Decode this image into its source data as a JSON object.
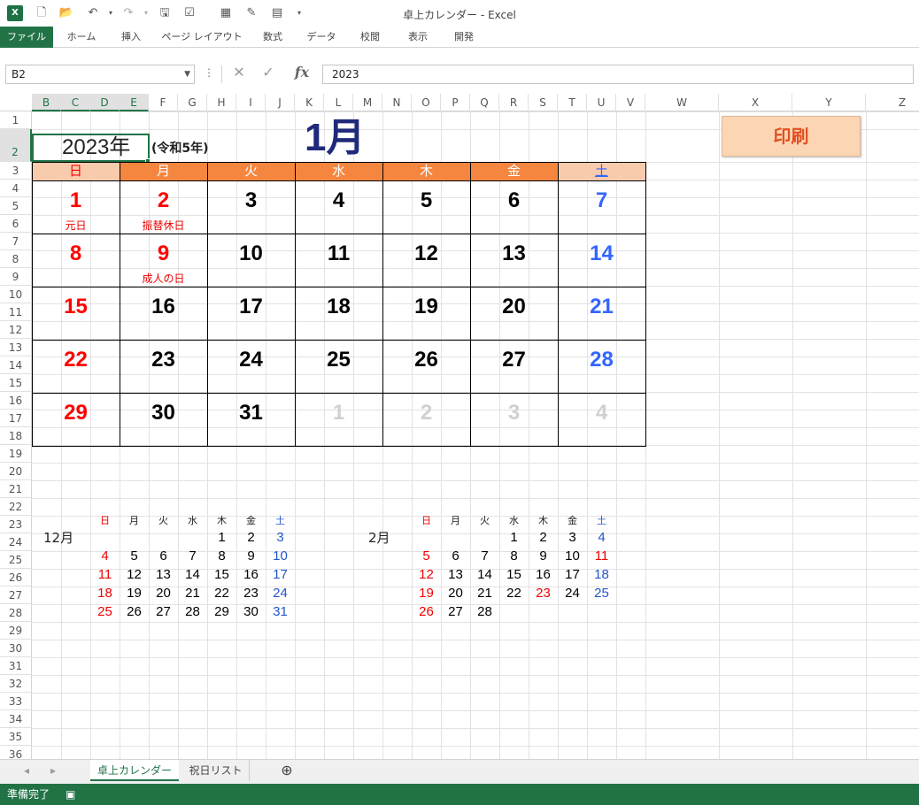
{
  "window": {
    "title": "卓上カレンダー - Excel",
    "app_icon": "X"
  },
  "quick_access": {
    "icons": [
      "new-file-icon",
      "open-folder-icon",
      "undo-icon",
      "redo-icon",
      "save-online-icon",
      "check-list-icon",
      "form-icon",
      "edit-icon",
      "chart-icon"
    ]
  },
  "ribbon": {
    "tabs": [
      "ファイル",
      "ホーム",
      "挿入",
      "ページ レイアウト",
      "数式",
      "データ",
      "校閲",
      "表示",
      "開発"
    ]
  },
  "formula_bar": {
    "name_box": "B2",
    "value": "2023",
    "fx": "fx"
  },
  "columns": [
    "B",
    "C",
    "D",
    "E",
    "F",
    "G",
    "H",
    "I",
    "J",
    "K",
    "L",
    "M",
    "N",
    "O",
    "P",
    "Q",
    "R",
    "S",
    "T",
    "U",
    "V",
    "W",
    "X",
    "Y",
    "Z"
  ],
  "rows": [
    "1",
    "2",
    "3",
    "4",
    "5",
    "6",
    "7",
    "8",
    "9",
    "10",
    "11",
    "12",
    "13",
    "14",
    "15",
    "16",
    "17",
    "18",
    "19",
    "20",
    "21",
    "22",
    "23",
    "24",
    "25",
    "26",
    "27",
    "28",
    "29",
    "30",
    "31",
    "32",
    "33",
    "34",
    "35",
    "36"
  ],
  "calendar": {
    "year_label": "2023年",
    "era_label": "(令和5年)",
    "month_label": "1月",
    "weekdays": [
      "日",
      "月",
      "火",
      "水",
      "木",
      "金",
      "土"
    ],
    "weeks": [
      [
        "1",
        "2",
        "3",
        "4",
        "5",
        "6",
        "7"
      ],
      [
        "8",
        "9",
        "10",
        "11",
        "12",
        "13",
        "14"
      ],
      [
        "15",
        "16",
        "17",
        "18",
        "19",
        "20",
        "21"
      ],
      [
        "22",
        "23",
        "24",
        "25",
        "26",
        "27",
        "28"
      ],
      [
        "29",
        "30",
        "31",
        "1",
        "2",
        "3",
        "4"
      ]
    ],
    "holidays": {
      "h1": "元日",
      "h2": "振替休日",
      "h9": "成人の日"
    }
  },
  "prev_month": {
    "label": "12月",
    "weekdays": [
      "日",
      "月",
      "火",
      "水",
      "木",
      "金",
      "土"
    ],
    "weeks": [
      [
        "",
        "",
        "",
        "",
        "1",
        "2",
        "3"
      ],
      [
        "4",
        "5",
        "6",
        "7",
        "8",
        "9",
        "10"
      ],
      [
        "11",
        "12",
        "13",
        "14",
        "15",
        "16",
        "17"
      ],
      [
        "18",
        "19",
        "20",
        "21",
        "22",
        "23",
        "24"
      ],
      [
        "25",
        "26",
        "27",
        "28",
        "29",
        "30",
        "31"
      ]
    ]
  },
  "next_month": {
    "label": "2月",
    "weekdays": [
      "日",
      "月",
      "火",
      "水",
      "木",
      "金",
      "土"
    ],
    "weeks": [
      [
        "",
        "",
        "",
        "1",
        "2",
        "3",
        "4"
      ],
      [
        "5",
        "6",
        "7",
        "8",
        "9",
        "10",
        "11"
      ],
      [
        "12",
        "13",
        "14",
        "15",
        "16",
        "17",
        "18"
      ],
      [
        "19",
        "20",
        "21",
        "22",
        "23",
        "24",
        "25"
      ],
      [
        "26",
        "27",
        "28",
        "",
        "",
        "",
        ""
      ]
    ]
  },
  "print_button": "印刷",
  "sheets": {
    "active": "卓上カレンダー",
    "other": "祝日リスト",
    "add": "⊕"
  },
  "status": {
    "text": "準備完了"
  },
  "colors": {
    "sunday": "#ff0000",
    "saturday": "#3366ff",
    "weekday": "#000000",
    "faded": "#d0d0d0",
    "header_orange": "#f48640",
    "header_light": "#f8cbad",
    "excel_green": "#217346"
  }
}
